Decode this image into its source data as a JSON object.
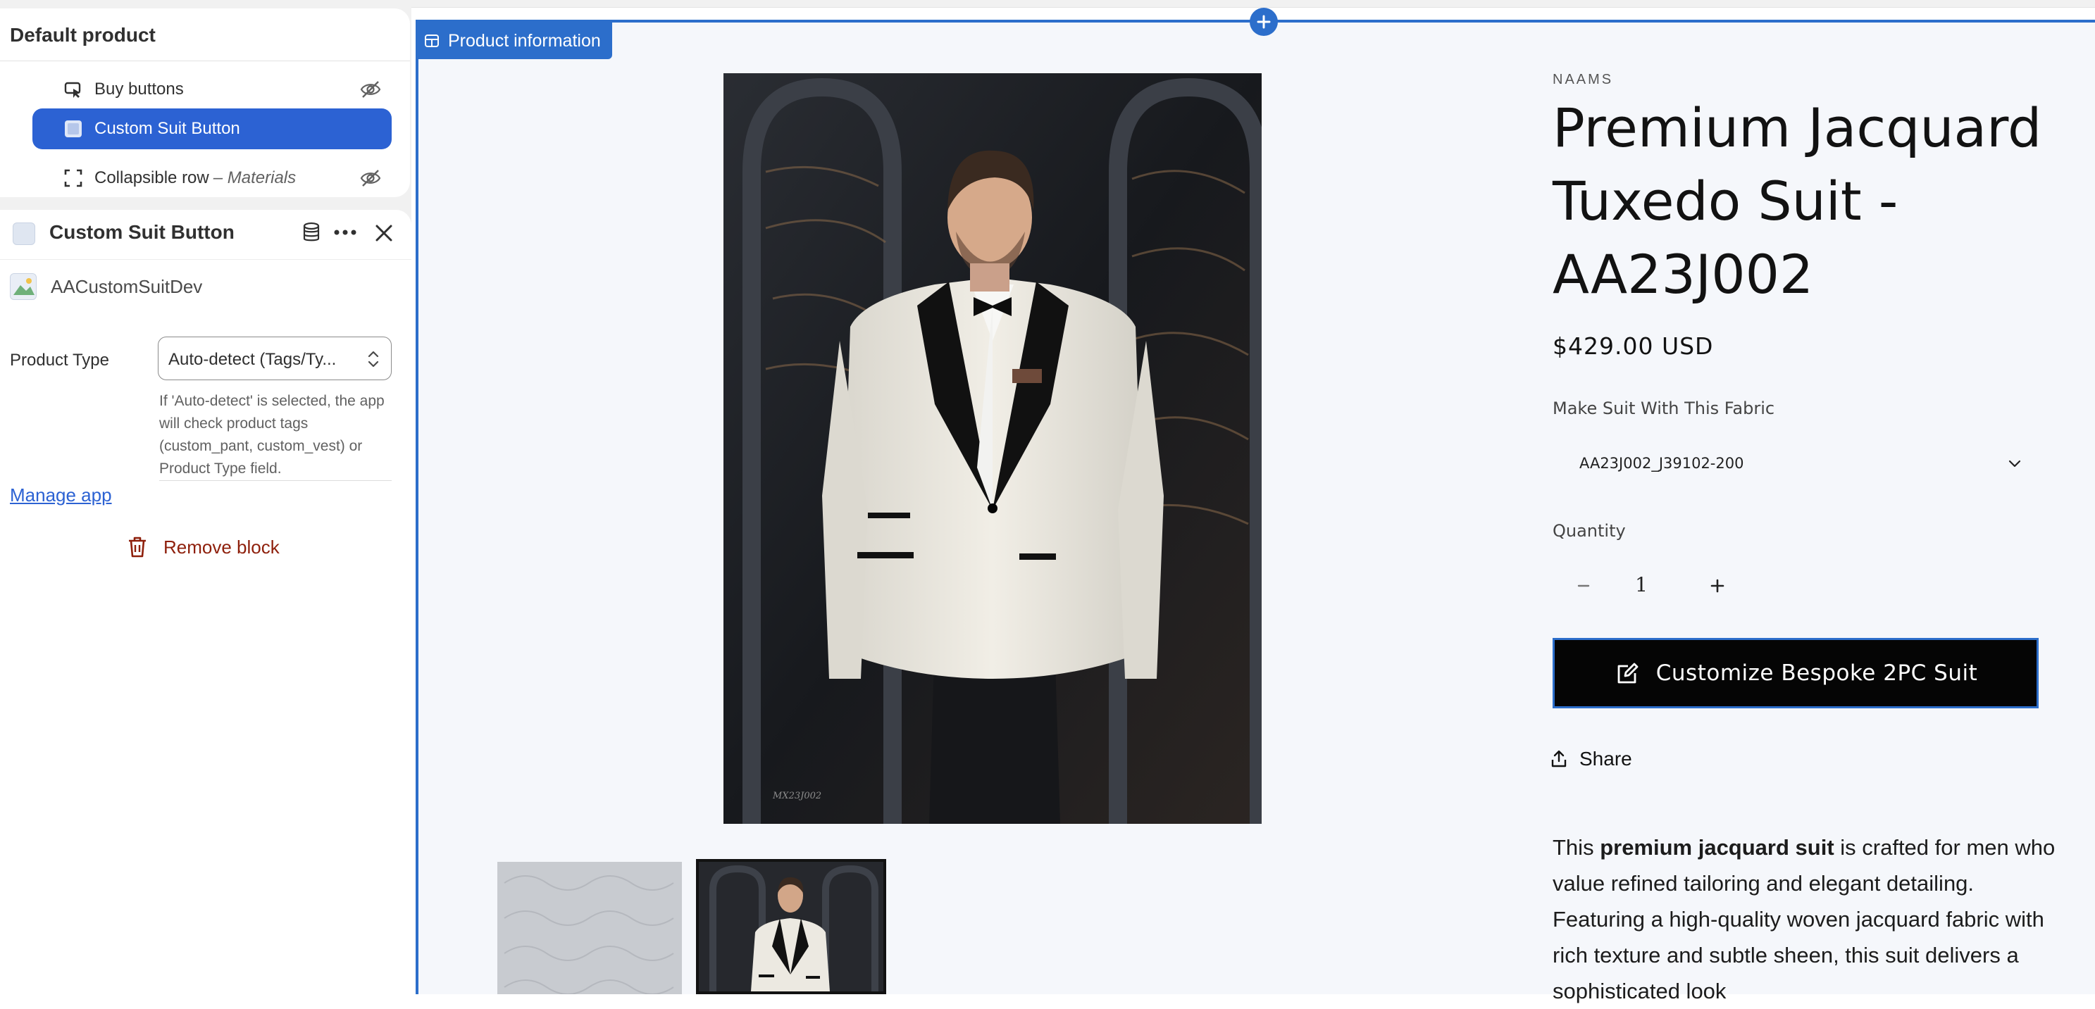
{
  "editor": {
    "tree": {
      "title": "Default product",
      "items": [
        {
          "label": "Buy buttons"
        },
        {
          "label": "Custom Suit Button"
        },
        {
          "label": "Collapsible row",
          "sublabel": "– Materials"
        }
      ]
    },
    "block": {
      "title": "Custom Suit Button",
      "app_name": "AACustomSuitDev",
      "product_type_label": "Product Type",
      "product_type_value": "Auto-detect (Tags/Ty...",
      "help_text": "If 'Auto-detect' is selected, the app will check product tags (custom_pant, custom_vest) or Product Type field.",
      "manage_app": "Manage app",
      "remove_block": "Remove block"
    }
  },
  "preview": {
    "section_tag": "Product information",
    "vendor": "NAAMS",
    "title": "Premium Jacquard Tuxedo Suit - AA23J002",
    "price": "$429.00 USD",
    "fabric_label": "Make Suit With This Fabric",
    "fabric_value": "AA23J002_J39102-200",
    "quantity_label": "Quantity",
    "quantity_value": "1",
    "cta_label": "Customize Bespoke 2PC Suit",
    "share_label": "Share",
    "description": {
      "pre": "This ",
      "bold": "premium jacquard suit",
      "post": " is crafted for men who value refined tailoring and elegant detailing. Featuring a high-quality woven jacquard fabric with rich texture and subtle sheen, this suit delivers a sophisticated look"
    },
    "photo_watermark": "MX23J002"
  },
  "colors": {
    "accent": "#2c6ecb",
    "selected": "#2c62d3",
    "danger": "#8e1f0b",
    "cta_bg": "#050505"
  }
}
